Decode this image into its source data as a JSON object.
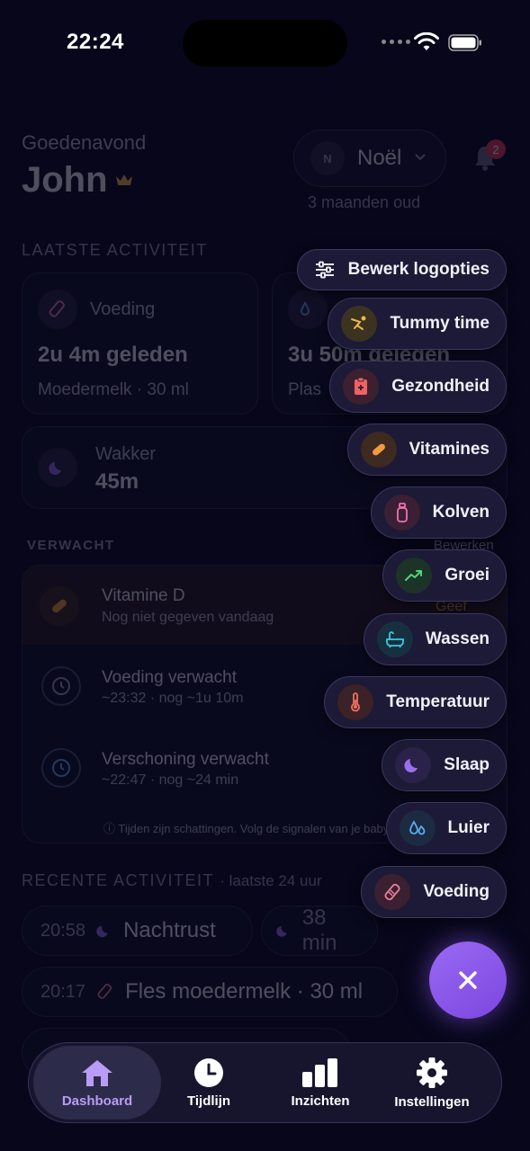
{
  "status_bar": {
    "time": "22:24"
  },
  "header": {
    "greeting": "Goedenavond",
    "user_name": "John",
    "child": {
      "initial": "N",
      "name": "Noël",
      "age": "3 maanden oud"
    },
    "notifications_count": "2"
  },
  "last_activity": {
    "title": "LAATSTE ACTIVITEIT",
    "cards": [
      {
        "label": "Voeding",
        "value": "2u 4m geleden",
        "detail": "Moedermelk · 30 ml"
      },
      {
        "label": "",
        "value": "3u 50m geleden",
        "detail": "Plas"
      }
    ],
    "awake": {
      "label": "Wakker",
      "value": "45m"
    }
  },
  "expected": {
    "title": "VERWACHT",
    "edit_label": "Bewerken",
    "items": [
      {
        "title": "Vitamine D",
        "subtitle": "Nog niet gegeven vandaag",
        "action": "Geef"
      },
      {
        "title": "Voeding verwacht",
        "subtitle": "~23:32 · nog ~1u 10m"
      },
      {
        "title": "Verschoning verwacht",
        "subtitle": "~22:47 · nog ~24 min"
      }
    ],
    "note": "Tijden zijn schattingen. Volg de signalen van je baby."
  },
  "recent": {
    "title": "RECENTE ACTIVITEIT",
    "range": "· laatste 24 uur",
    "items": [
      {
        "time": "20:58",
        "label": "Nachtrust",
        "duration": "38 min"
      },
      {
        "time": "20:17",
        "label": "Fles moedermelk · 30 ml"
      }
    ]
  },
  "fab_menu": {
    "edit_label": "Bewerk logopties",
    "items": [
      {
        "label": "Tummy time",
        "icon": "tummy-time-icon",
        "color": "#e8b84a",
        "bg": "#3b3320"
      },
      {
        "label": "Gezondheid",
        "icon": "clipboard-icon",
        "color": "#f06262",
        "bg": "#3c2030"
      },
      {
        "label": "Vitamines",
        "icon": "pill-icon",
        "color": "#f39a3c",
        "bg": "#3d2a20"
      },
      {
        "label": "Kolven",
        "icon": "bottle-icon",
        "color": "#f070b0",
        "bg": "#3a1f35"
      },
      {
        "label": "Groei",
        "icon": "trend-up-icon",
        "color": "#4fd67a",
        "bg": "#1c3328"
      },
      {
        "label": "Wassen",
        "icon": "bathtub-icon",
        "color": "#3fc7e0",
        "bg": "#173040"
      },
      {
        "label": "Temperatuur",
        "icon": "thermometer-icon",
        "color": "#f07060",
        "bg": "#3b2226"
      },
      {
        "label": "Slaap",
        "icon": "moon-icon",
        "color": "#9a70f0",
        "bg": "#2a2248"
      },
      {
        "label": "Luier",
        "icon": "droplets-icon",
        "color": "#5aaaf0",
        "bg": "#1c2a42"
      },
      {
        "label": "Voeding",
        "icon": "feeding-bottle-icon",
        "color": "#f07fa0",
        "bg": "#3a2030"
      }
    ]
  },
  "tabs": [
    {
      "label": "Dashboard",
      "icon": "home-icon"
    },
    {
      "label": "Tijdlijn",
      "icon": "clock-icon"
    },
    {
      "label": "Inzichten",
      "icon": "bar-chart-icon"
    },
    {
      "label": "Instellingen",
      "icon": "gear-icon"
    }
  ],
  "colors": {
    "accent": "#8b5cf6",
    "background": "#07061a"
  }
}
